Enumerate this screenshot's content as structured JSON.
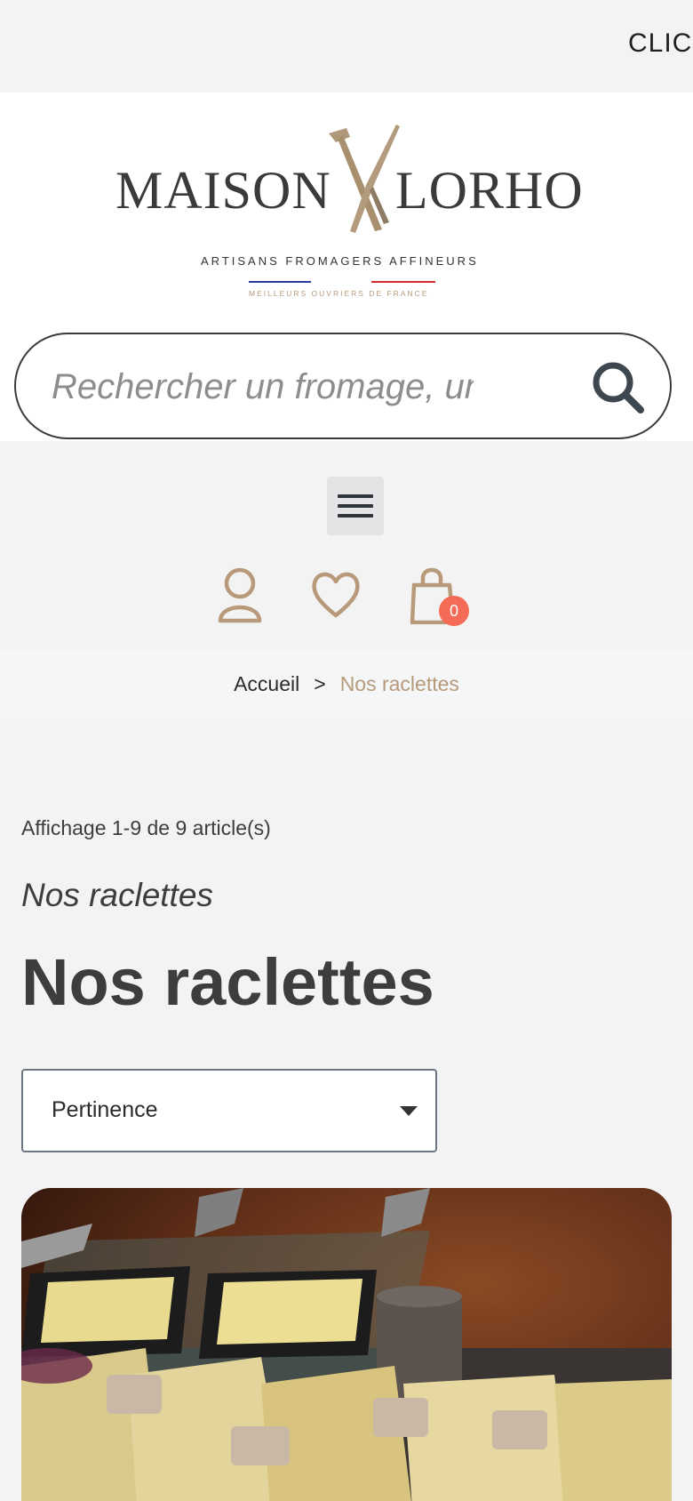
{
  "topbar": {
    "ticker": "CLIC"
  },
  "logo": {
    "word_left": "MAISON",
    "word_right": "LORHO",
    "tagline": "ARTISANS FROMAGERS AFFINEURS",
    "mof": "MEILLEURS OUVRIERS DE FRANCE"
  },
  "search": {
    "placeholder": "Rechercher un fromage, un"
  },
  "cart": {
    "count": "0"
  },
  "breadcrumb": {
    "home": "Accueil",
    "separator": ">",
    "current": "Nos raclettes"
  },
  "listing": {
    "count_text": "Affichage 1-9 de 9 article(s)",
    "subtitle": "Nos raclettes",
    "title": "Nos raclettes",
    "sort_selected": "Pertinence"
  },
  "colors": {
    "accent": "#b89a7a",
    "badge": "#f56b57",
    "text": "#3d3d3d"
  }
}
